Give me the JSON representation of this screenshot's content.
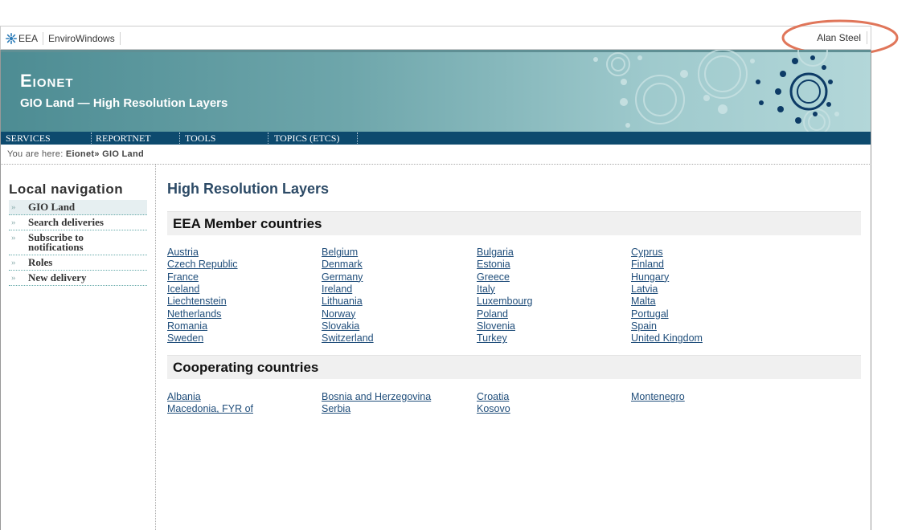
{
  "topbar": {
    "eea_label": "EEA",
    "envirowindows_label": "EnviroWindows",
    "user_name": "Alan Steel"
  },
  "header": {
    "site_title": "Eionet",
    "subtitle": "GIO Land — High Resolution Layers"
  },
  "nav": {
    "items": [
      {
        "label": "SERVICES"
      },
      {
        "label": "REPORTNET"
      },
      {
        "label": "TOOLS"
      },
      {
        "label": "TOPICS (ETCS)"
      }
    ]
  },
  "breadcrumb": {
    "prefix": "You are here:",
    "home": "Eionet",
    "separator": "»",
    "current": "GIO Land"
  },
  "local_nav": {
    "title": "Local navigation",
    "bullet": "»",
    "items": [
      {
        "label": "GIO Land"
      },
      {
        "label": "Search deliveries"
      },
      {
        "label": "Subscribe to notifications"
      },
      {
        "label": "Roles"
      },
      {
        "label": "New delivery"
      }
    ]
  },
  "main": {
    "heading": "High Resolution Layers",
    "member_heading": "EEA Member countries",
    "member_countries": [
      [
        "Austria",
        "Belgium",
        "Bulgaria",
        "Cyprus"
      ],
      [
        "Czech Republic",
        "Denmark",
        "Estonia",
        "Finland"
      ],
      [
        "France",
        "Germany",
        "Greece",
        "Hungary"
      ],
      [
        "Iceland",
        "Ireland",
        "Italy",
        "Latvia"
      ],
      [
        "Liechtenstein",
        "Lithuania",
        "Luxembourg",
        "Malta"
      ],
      [
        "Netherlands",
        "Norway",
        "Poland",
        "Portugal"
      ],
      [
        "Romania",
        "Slovakia",
        "Slovenia",
        "Spain"
      ],
      [
        "Sweden",
        "Switzerland",
        "Turkey",
        "United Kingdom"
      ]
    ],
    "cooperating_heading": "Cooperating countries",
    "cooperating_countries": [
      [
        "Albania",
        "Bosnia and Herzegovina",
        "Croatia",
        "Montenegro"
      ],
      [
        "Macedonia, FYR of",
        "Serbia",
        "Kosovo"
      ]
    ]
  },
  "colors": {
    "nav_bar": "#0d4a6e",
    "link": "#1f4d7a",
    "heading": "#2c4a66",
    "annotation_ring": "#e0765a"
  },
  "icons": {
    "eea_logo": "eea-star-icon"
  }
}
